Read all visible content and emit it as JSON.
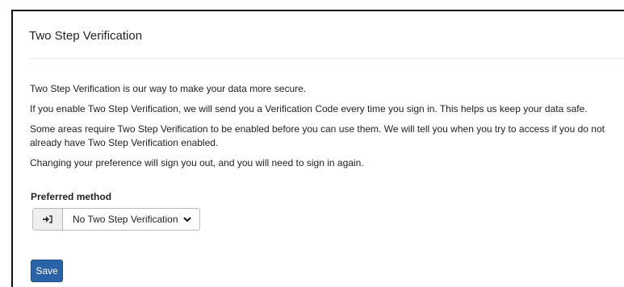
{
  "panel": {
    "title": "Two Step Verification"
  },
  "content": {
    "paragraphs": [
      "Two Step Verification is our way to make your data more secure.",
      "If you enable Two Step Verification, we will send you a Verification Code every time you sign in. This helps us keep your data safe.",
      "Some areas require Two Step Verification to be enabled before you can use them. We will tell you when you try to access if you do not already have Two Step Verification enabled.",
      "Changing your preference will sign you out, and you will need to sign in again."
    ]
  },
  "form": {
    "preferred_method_label": "Preferred method",
    "addon_icon": "sign-in-icon",
    "selected_method": "No Two Step Verification",
    "save_label": "Save"
  },
  "colors": {
    "primary_button": "#2a63a8",
    "border": "#bdbdbd"
  }
}
